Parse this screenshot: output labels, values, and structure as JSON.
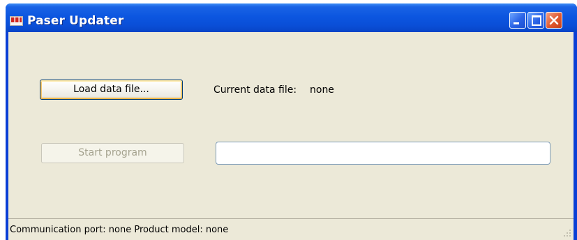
{
  "window": {
    "title": "Paser Updater"
  },
  "buttons": {
    "load_label": "Load data file...",
    "start_label": "Start program"
  },
  "data_file": {
    "label": "Current data file:",
    "value": "none"
  },
  "status": {
    "port_label": "Communication port:",
    "port_value": "none",
    "model_label": "Product model:",
    "model_value": "none"
  },
  "progress": {
    "value_fraction": 0
  },
  "colors": {
    "titlebar": "#0a4fd8",
    "client": "#ece9d8",
    "close": "#e1582f"
  },
  "icons": [
    "app-icon",
    "minimize-icon",
    "maximize-icon",
    "close-icon",
    "resize-grip-icon"
  ]
}
